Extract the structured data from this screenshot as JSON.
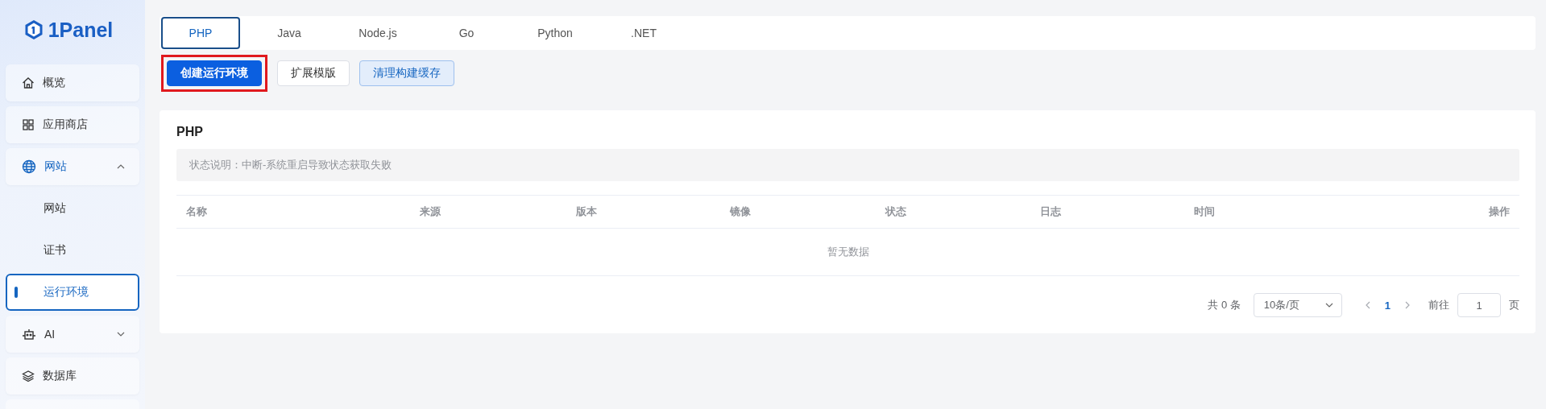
{
  "sidebar": {
    "logo": "1Panel",
    "items": [
      {
        "kind": "item",
        "label": "概览",
        "selected": false
      },
      {
        "kind": "item",
        "label": "应用商店",
        "selected": false
      },
      {
        "kind": "group",
        "label": "网站",
        "expanded": true,
        "children": [
          {
            "label": "网站",
            "selected": false
          },
          {
            "label": "证书",
            "selected": false
          },
          {
            "label": "运行环境",
            "selected": true
          }
        ]
      },
      {
        "kind": "group",
        "label": "AI",
        "expanded": false
      },
      {
        "kind": "item",
        "label": "数据库",
        "selected": false
      }
    ]
  },
  "tabs": [
    {
      "label": "PHP",
      "selected": true
    },
    {
      "label": "Java",
      "selected": false
    },
    {
      "label": "Node.js",
      "selected": false
    },
    {
      "label": "Go",
      "selected": false
    },
    {
      "label": "Python",
      "selected": false
    },
    {
      "label": ".NET",
      "selected": false
    }
  ],
  "actions": [
    {
      "label": "创建运行环境",
      "kind": "primary",
      "highlighted": true
    },
    {
      "label": "扩展模版",
      "kind": "plain",
      "highlighted": false
    },
    {
      "label": "清理构建缓存",
      "kind": "light",
      "highlighted": false
    }
  ],
  "card": {
    "title": "PHP",
    "notice": "状态说明：中断-系统重启导致状态获取失败",
    "table": {
      "columns": [
        "名称",
        "来源",
        "版本",
        "镜像",
        "状态",
        "日志",
        "时间",
        "操作"
      ],
      "empty_text": "暂无数据"
    },
    "pagination": {
      "total": "共 0 条",
      "page_size": "10条/页",
      "pages": [
        {
          "label": "1",
          "selected": true
        }
      ],
      "goto_label": "前往",
      "goto_value": "1",
      "goto_suffix": "页"
    }
  }
}
